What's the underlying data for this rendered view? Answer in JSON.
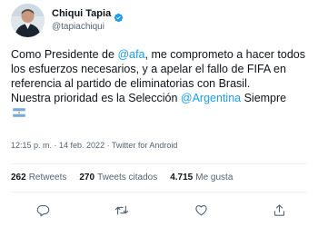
{
  "tweet": {
    "display_name": "Chiqui Tapia",
    "handle": "@tapiachiqui",
    "text_parts": {
      "p1": "Como Presidente de ",
      "m1": "@afa",
      "p2": ", me comprometo a hacer todos los esfuerzos necesarios, y a apelar el fallo de FIFA en referencia al partido de eliminatorias con Brasil.",
      "p3": "Nuestra prioridad es la Selección ",
      "m2": "@Argentina",
      "p4": " Siempre"
    },
    "meta": "12:15 p. m. · 14 feb. 2022 · Twitter for Android"
  },
  "stats": {
    "retweets_count": "262",
    "retweets_label": "Retweets",
    "quotes_count": "270",
    "quotes_label": "Tweets citados",
    "likes_count": "4.715",
    "likes_label": "Me gusta"
  },
  "icons": {
    "verified": "verified-badge-icon",
    "flag": "argentina-flag-icon",
    "reply": "reply-icon",
    "retweet": "retweet-icon",
    "like": "heart-icon",
    "share": "share-icon"
  },
  "colors": {
    "accent": "#1d9bf0",
    "text": "#0f1419",
    "muted": "#536471",
    "divider": "#eff3f4"
  }
}
